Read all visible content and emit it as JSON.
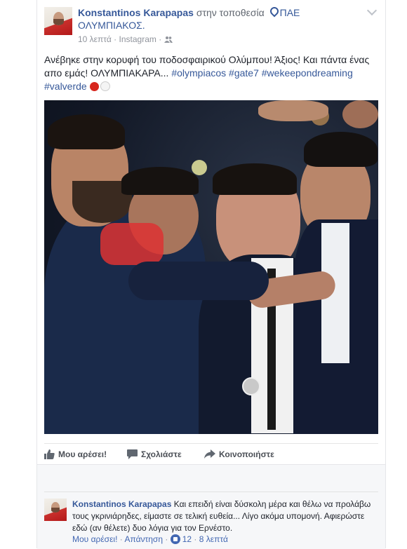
{
  "post": {
    "author": "Konstantinos Karapapas",
    "location_prefix": "στην τοποθεσία",
    "page_name": "ΠΑΕ ΟΛΥΜΠΙΑΚΟΣ.",
    "time": "10 λεπτά",
    "via": "Instagram",
    "meta_separator": "·",
    "text": "Ανέβηκε στην κορυφή του ποδοσφαιρικού Ολύμπου! Άξιος! Και πάντα ένας απο εμάς! ΟΛΥΜΠΙΑΚΑΡΑ...",
    "hashtags": [
      "#olympiacos",
      "#gate7",
      "#wekeepondreaming",
      "#valverde"
    ]
  },
  "actions": {
    "like": "Μου αρέσει!",
    "comment": "Σχολιάστε",
    "share": "Κοινοποιήστε"
  },
  "comment": {
    "author": "Konstantinos Karapapas",
    "text": "Και επειδή είναι δύσκολη μέρα και θέλω να προλάβω τους γκρινιάρηδες, είμαστε σε τελική ευθεία... Λίγο ακόμα υπομονή. Αφιερώστε εδώ (αν θέλετε) δυο λόγια για τον Ερνέστο.",
    "like_link": "Μου αρέσει!",
    "reply_link": "Απάντηση",
    "reaction_count": "12",
    "time": "8 λεπτά",
    "separator": "·"
  },
  "colors": {
    "link": "#365899",
    "meta": "#90949c",
    "accent_red": "#d7261d"
  }
}
